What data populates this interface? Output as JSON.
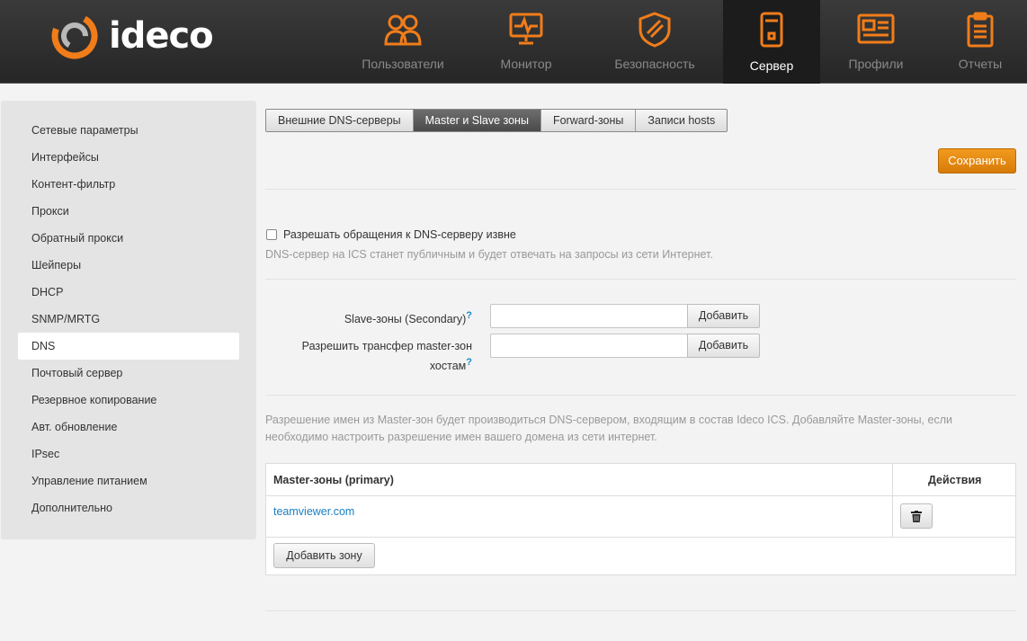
{
  "brand": {
    "name": "ideco"
  },
  "nav": {
    "items": [
      {
        "label": "Пользователи",
        "icon": "users-icon"
      },
      {
        "label": "Монитор",
        "icon": "monitor-icon"
      },
      {
        "label": "Безопасность",
        "icon": "shield-icon"
      },
      {
        "label": "Сервер",
        "icon": "server-icon",
        "active": true
      },
      {
        "label": "Профили",
        "icon": "profiles-icon"
      },
      {
        "label": "Отчеты",
        "icon": "reports-icon"
      }
    ]
  },
  "sidebar": {
    "items": [
      {
        "label": "Сетевые параметры"
      },
      {
        "label": "Интерфейсы"
      },
      {
        "label": "Контент-фильтр"
      },
      {
        "label": "Прокси"
      },
      {
        "label": "Обратный прокси"
      },
      {
        "label": "Шейперы"
      },
      {
        "label": "DHCP"
      },
      {
        "label": "SNMP/MRTG"
      },
      {
        "label": "DNS",
        "active": true
      },
      {
        "label": "Почтовый сервер"
      },
      {
        "label": "Резервное копирование"
      },
      {
        "label": "Авт. обновление"
      },
      {
        "label": "IPsec"
      },
      {
        "label": "Управление питанием"
      },
      {
        "label": "Дополнительно"
      }
    ]
  },
  "tabs": [
    {
      "label": "Внешние DNS-серверы"
    },
    {
      "label": "Master и Slave зоны",
      "active": true
    },
    {
      "label": "Forward-зоны"
    },
    {
      "label": "Записи hosts"
    }
  ],
  "toolbar": {
    "save_label": "Сохранить"
  },
  "external_access": {
    "checkbox_label": "Разрешать обращения к DNS-серверу извне",
    "checked": false,
    "hint": "DNS-сервер на ICS станет публичным и будет отвечать на запросы из сети Интернет."
  },
  "slave": {
    "label": "Slave-зоны (Secondary)",
    "help": "?",
    "value": "",
    "add_label": "Добавить"
  },
  "transfer": {
    "label_line1": "Разрешить трансфер master-зон",
    "label_line2": "хостам",
    "help": "?",
    "value": "",
    "add_label": "Добавить"
  },
  "master_hint": {
    "line1": "Разрешение имен из Master-зон будет производиться DNS-сервером, входящим в состав Ideco ICS. Добавляйте Master-зоны, если",
    "line2": "необходимо настроить разрешение имен вашего домена из сети интернет."
  },
  "table": {
    "col_zone": "Master-зоны (primary)",
    "col_actions": "Действия",
    "rows": [
      {
        "zone": "teamviewer.com"
      }
    ],
    "add_zone_label": "Добавить зону"
  },
  "colors": {
    "accent": "#f07d1a",
    "link": "#1a7fc1"
  }
}
